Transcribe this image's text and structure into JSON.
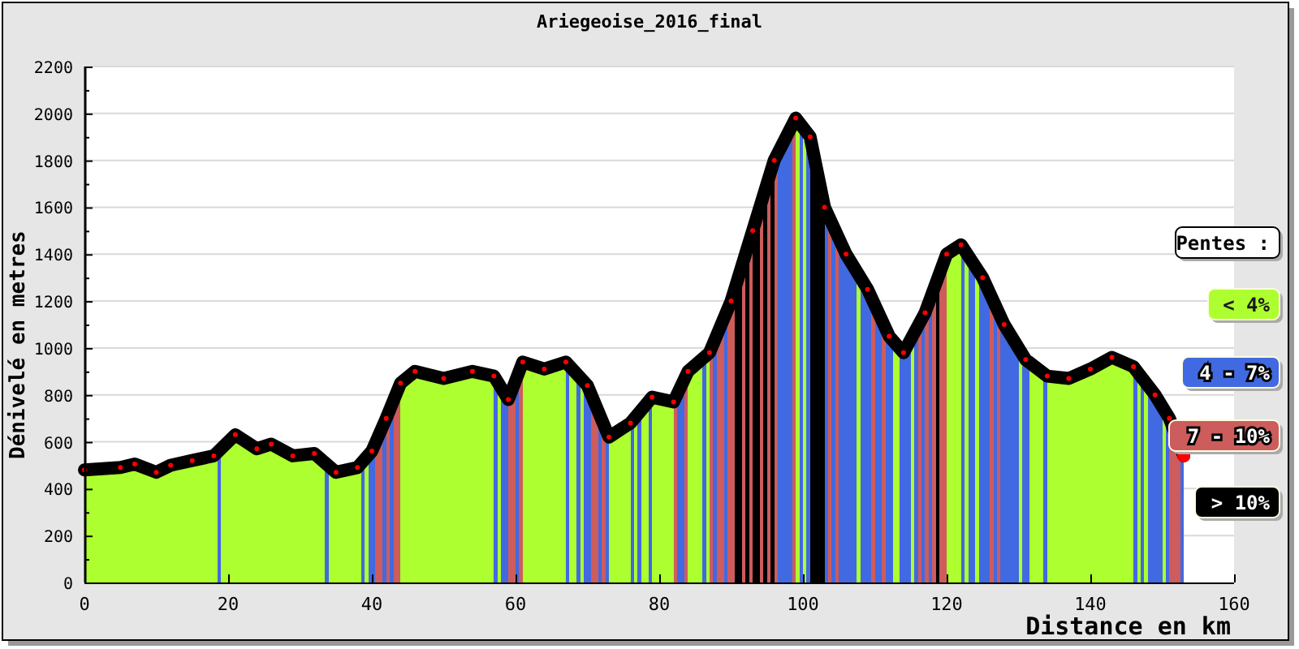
{
  "chart": {
    "title": "Ariegeoise_2016_final",
    "chart_data": {
      "type": "area",
      "xlabel": "Distance en km",
      "ylabel": "Dénivelé en metres",
      "x": [
        0,
        5,
        7,
        10,
        12,
        15,
        18,
        21,
        24,
        26,
        29,
        32,
        35,
        38,
        40,
        42,
        44,
        46,
        50,
        54,
        57,
        59,
        61,
        64,
        67,
        70,
        73,
        76,
        79,
        82,
        84,
        87,
        90,
        93,
        96,
        99,
        101,
        103,
        106,
        109,
        112,
        114,
        117,
        120,
        122,
        125,
        128,
        131,
        134,
        137,
        140,
        143,
        146,
        149,
        151,
        153
      ],
      "series": [
        {
          "color": "#000000",
          "values": [
            480,
            490,
            505,
            470,
            500,
            520,
            540,
            630,
            570,
            590,
            540,
            550,
            470,
            490,
            560,
            700,
            850,
            900,
            870,
            900,
            880,
            780,
            940,
            910,
            940,
            840,
            620,
            680,
            790,
            770,
            900,
            980,
            1200,
            1500,
            1800,
            1980,
            1900,
            1600,
            1400,
            1250,
            1050,
            980,
            1150,
            1400,
            1440,
            1300,
            1100,
            950,
            880,
            870,
            910,
            960,
            920,
            800,
            700,
            540
          ]
        }
      ],
      "grid": true,
      "xlim": [
        0,
        160
      ],
      "ylim": [
        0,
        2200
      ],
      "xticks": [
        0,
        20,
        40,
        60,
        80,
        100,
        120,
        140,
        160
      ],
      "yticks": [
        0,
        200,
        400,
        600,
        800,
        1000,
        1200,
        1400,
        1600,
        1800,
        2000,
        2200
      ]
    }
  },
  "legend": {
    "title": "Pentes :",
    "items": [
      {
        "label": "< 4%",
        "color": "#adff2f"
      },
      {
        "label": "4 - 7%",
        "color": "#4169e1"
      },
      {
        "label": "7 - 10%",
        "color": "#cd5c5c"
      },
      {
        "label": "> 10%",
        "color": "#000000"
      }
    ]
  }
}
